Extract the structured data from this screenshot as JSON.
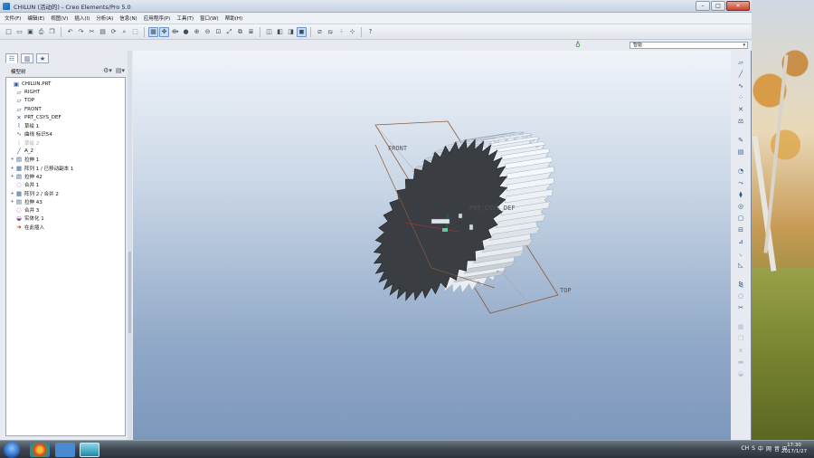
{
  "window": {
    "title": "CHILUN (活动的) - Creo Elements/Pro 5.0",
    "controls": {
      "minimize": "–",
      "maximize": "□",
      "close": "✕"
    }
  },
  "menu": [
    "文件(F)",
    "编辑(E)",
    "视图(V)",
    "插入(I)",
    "分析(A)",
    "信息(N)",
    "应用程序(P)",
    "工具(T)",
    "窗口(W)",
    "帮助(H)"
  ],
  "toolbar_icons": [
    "new-icon",
    "open-icon",
    "save-icon",
    "print-icon",
    "copy-icon",
    "undo-icon",
    "redo-icon",
    "cut-icon",
    "paste-icon",
    "regenerate-icon",
    "find-icon",
    "select-box-icon",
    "repaint-icon",
    "spin-center-icon",
    "orient-icon",
    "shading-icon",
    "zoom-in-icon",
    "zoom-out-icon",
    "refit-icon",
    "reorient-icon",
    "saved-views-icon",
    "layers-icon",
    "wireframe-icon",
    "hidden-line-icon",
    "no-hidden-icon",
    "shaded-icon",
    "datum-planes-icon",
    "datum-axes-icon",
    "datum-points-icon",
    "csys-icon",
    "whats-this-icon"
  ],
  "filter": {
    "value": "智能"
  },
  "model_tree": {
    "header": "模型树",
    "items": [
      {
        "label": "CHILUN.PRT",
        "icon": "part-icon",
        "expand": ""
      },
      {
        "label": "RIGHT",
        "icon": "datum-plane-icon",
        "expand": ""
      },
      {
        "label": "TOP",
        "icon": "datum-plane-icon",
        "expand": ""
      },
      {
        "label": "FRONT",
        "icon": "datum-plane-icon",
        "expand": ""
      },
      {
        "label": "PRT_CSYS_DEF",
        "icon": "csys-icon",
        "expand": ""
      },
      {
        "label": "草绘 1",
        "icon": "sketch-icon",
        "expand": ""
      },
      {
        "label": "曲线 标识54",
        "icon": "curve-icon",
        "expand": ""
      },
      {
        "label": "草绘 2",
        "icon": "sketch-icon",
        "expand": "",
        "dim": true
      },
      {
        "label": "A_2",
        "icon": "axis-icon",
        "expand": ""
      },
      {
        "label": "拉伸 1",
        "icon": "extrude-icon",
        "expand": "+"
      },
      {
        "label": "阵列 1 / 已移动副本 1",
        "icon": "pattern-icon",
        "expand": "+"
      },
      {
        "label": "拉伸 42",
        "icon": "extrude-icon",
        "expand": "+"
      },
      {
        "label": "合并 1",
        "icon": "merge-icon",
        "expand": ""
      },
      {
        "label": "阵列 2 / 合并 2",
        "icon": "pattern-icon",
        "expand": "+"
      },
      {
        "label": "拉伸 43",
        "icon": "extrude-icon",
        "expand": "+"
      },
      {
        "label": "合并 3",
        "icon": "merge-icon",
        "expand": ""
      },
      {
        "label": "实体化 1",
        "icon": "solidify-icon",
        "expand": ""
      },
      {
        "label": "在此插入",
        "icon": "insert-here-icon",
        "expand": ""
      }
    ]
  },
  "viewport": {
    "datum_labels": {
      "front": "FRONT",
      "top": "TOP",
      "csys": "PRT_CSYS_DEF"
    },
    "gear_teeth": 40
  },
  "right_toolbar_icons": [
    "plane-icon",
    "axis-icon",
    "curve-icon",
    "point-icon",
    "csys-icon",
    "analysis-icon",
    "sketch-icon",
    "extrude-icon",
    "revolve-icon",
    "sweep-icon",
    "blend-icon",
    "hole-icon",
    "shell-icon",
    "rib-icon",
    "draft-icon",
    "round-icon",
    "chamfer-icon",
    "mirror-icon",
    "merge-icon",
    "trim-icon",
    "pattern-icon",
    "copy-icon",
    "offset-icon",
    "thicken-icon",
    "solidify-icon"
  ],
  "taskbar": {
    "tray": [
      "CH",
      "S",
      "中",
      "网",
      "音",
      "⊞"
    ],
    "time": "17:30",
    "date": "2017/1/27"
  },
  "colors": {
    "gear_face": "#3a3d42",
    "gear_tooth": "#e9edf2",
    "datum": "#8a5a3c",
    "viewport_top": "#f0f4f9",
    "viewport_bottom": "#7d98bd"
  }
}
